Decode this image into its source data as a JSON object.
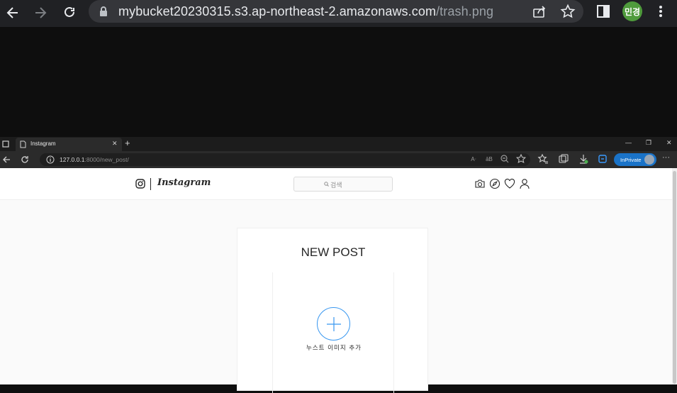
{
  "outer_browser": {
    "url_host": "mybucket20230315.s3.ap-northeast-2.amazonaws.com",
    "url_path": "/trash.png",
    "profile_initials": "민경"
  },
  "inner_browser": {
    "tab_title": "Instagram",
    "url_host": "127.0.0.1",
    "url_rest": ":8000/new_post/",
    "inprivate_label": "InPrivate"
  },
  "page": {
    "logo_text": "Instagram",
    "search_placeholder": "검색",
    "card_title": "NEW POST",
    "upload_label": "누스트 이미지 추가"
  },
  "colors": {
    "accent": "#3897f0",
    "profile_avatar": "#4f9b3c",
    "inprivate_badge": "#1a73c8"
  }
}
